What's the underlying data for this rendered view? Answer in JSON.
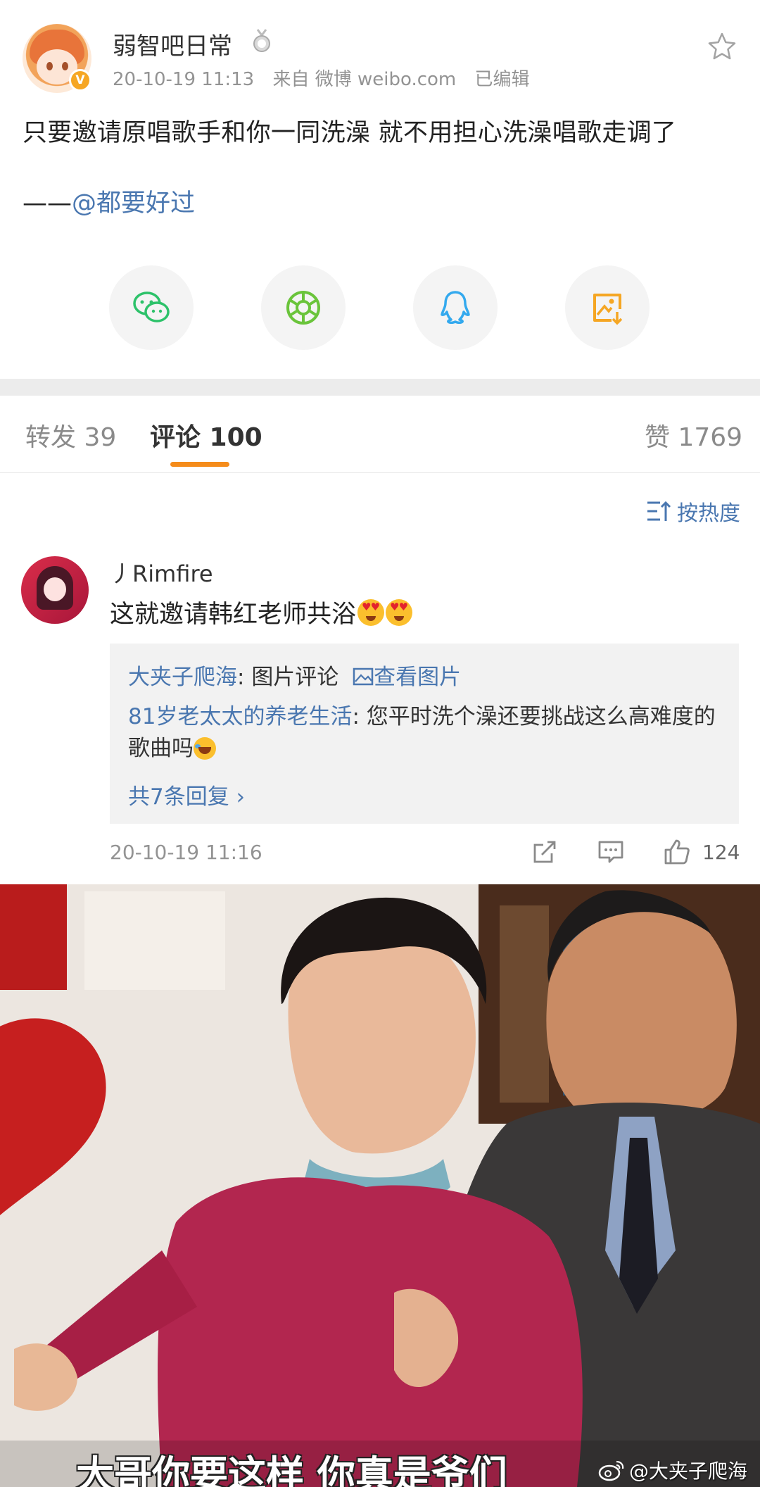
{
  "post": {
    "username": "弱智吧日常",
    "timestamp": "20-10-19 11:13",
    "source": "来自 微博 weibo.com",
    "edited": "已编辑",
    "text": "只要邀请原唱歌手和你一同洗澡 就不用担心洗澡唱歌走调了",
    "credit_prefix": "——",
    "credit_mention": "@都要好过",
    "verify_mark": "V",
    "icons": [
      "medal-icon",
      "star-icon"
    ]
  },
  "share": {
    "items": [
      {
        "name": "wechat",
        "icon": "wechat-icon",
        "color": "#2dc26a"
      },
      {
        "name": "moments",
        "icon": "moments-icon",
        "color": "#6ac43b"
      },
      {
        "name": "qq",
        "icon": "qq-icon",
        "color": "#33a9ee"
      },
      {
        "name": "save-image",
        "icon": "save-image-icon",
        "color": "#f5a623"
      }
    ]
  },
  "tabs": {
    "repost": "转发 39",
    "comments": "评论 100",
    "likes": "赞 1769",
    "active": "comments",
    "indicator_color": "#f58c1b"
  },
  "sort": {
    "label": "按热度",
    "icon": "sort-icon"
  },
  "comment": {
    "username": "丿Rimfire",
    "text": "这就邀请韩红老师共浴",
    "emojis": [
      "heart-eyes-emoji",
      "heart-eyes-emoji"
    ],
    "timestamp": "20-10-19 11:16",
    "like_count": "124",
    "actions": [
      "share-icon",
      "reply-icon",
      "like-icon"
    ],
    "replies": [
      {
        "user": "大夹子爬海",
        "sep": ": ",
        "text": "图片评论",
        "link": "查看图片"
      },
      {
        "user": "81岁老太太的养老生活",
        "sep": ": ",
        "text": "您平时洗个澡还要挑战这么高难度的歌曲吗",
        "emoji": "laugh-cry-emoji"
      }
    ],
    "more_replies": "共7条回复 ›"
  },
  "photo": {
    "caption": "大哥你要这样  你真是爷们",
    "watermark": "@大夹子爬海"
  },
  "colors": {
    "link": "#4a77b0",
    "accent": "#f58c1b",
    "meta": "#939393"
  }
}
